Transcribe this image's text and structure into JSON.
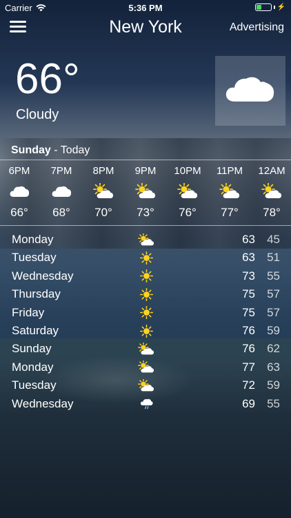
{
  "status_bar": {
    "carrier": "Carrier",
    "time": "5:36 PM",
    "battery_level": 0.35
  },
  "nav": {
    "city": "New York",
    "advertising": "Advertising"
  },
  "current": {
    "temperature": "66°",
    "condition": "Cloudy",
    "icon": "cloud-icon"
  },
  "today": {
    "day": "Sunday",
    "suffix": "- Today"
  },
  "hourly": [
    {
      "time": "6PM",
      "temp": "66°",
      "icon": "cloud"
    },
    {
      "time": "7PM",
      "temp": "68°",
      "icon": "cloud"
    },
    {
      "time": "8PM",
      "temp": "70°",
      "icon": "partly-sunny"
    },
    {
      "time": "9PM",
      "temp": "73°",
      "icon": "partly-sunny"
    },
    {
      "time": "10PM",
      "temp": "76°",
      "icon": "partly-sunny"
    },
    {
      "time": "11PM",
      "temp": "77°",
      "icon": "partly-sunny"
    },
    {
      "time": "12AM",
      "temp": "78°",
      "icon": "partly-sunny"
    }
  ],
  "daily": [
    {
      "day": "Monday",
      "high": "63",
      "low": "45",
      "icon": "partly-sunny"
    },
    {
      "day": "Tuesday",
      "high": "63",
      "low": "51",
      "icon": "sun"
    },
    {
      "day": "Wednesday",
      "high": "73",
      "low": "55",
      "icon": "sun"
    },
    {
      "day": "Thursday",
      "high": "75",
      "low": "57",
      "icon": "sun"
    },
    {
      "day": "Friday",
      "high": "75",
      "low": "57",
      "icon": "sun"
    },
    {
      "day": "Saturday",
      "high": "76",
      "low": "59",
      "icon": "sun"
    },
    {
      "day": "Sunday",
      "high": "76",
      "low": "62",
      "icon": "partly-sunny"
    },
    {
      "day": "Monday",
      "high": "77",
      "low": "63",
      "icon": "partly-sunny"
    },
    {
      "day": "Tuesday",
      "high": "72",
      "low": "59",
      "icon": "partly-sunny"
    },
    {
      "day": "Wednesday",
      "high": "69",
      "low": "55",
      "icon": "rain"
    }
  ],
  "colors": {
    "sun": "#ffd21e",
    "cloud": "#ffffff",
    "battery": "#4cd964"
  }
}
